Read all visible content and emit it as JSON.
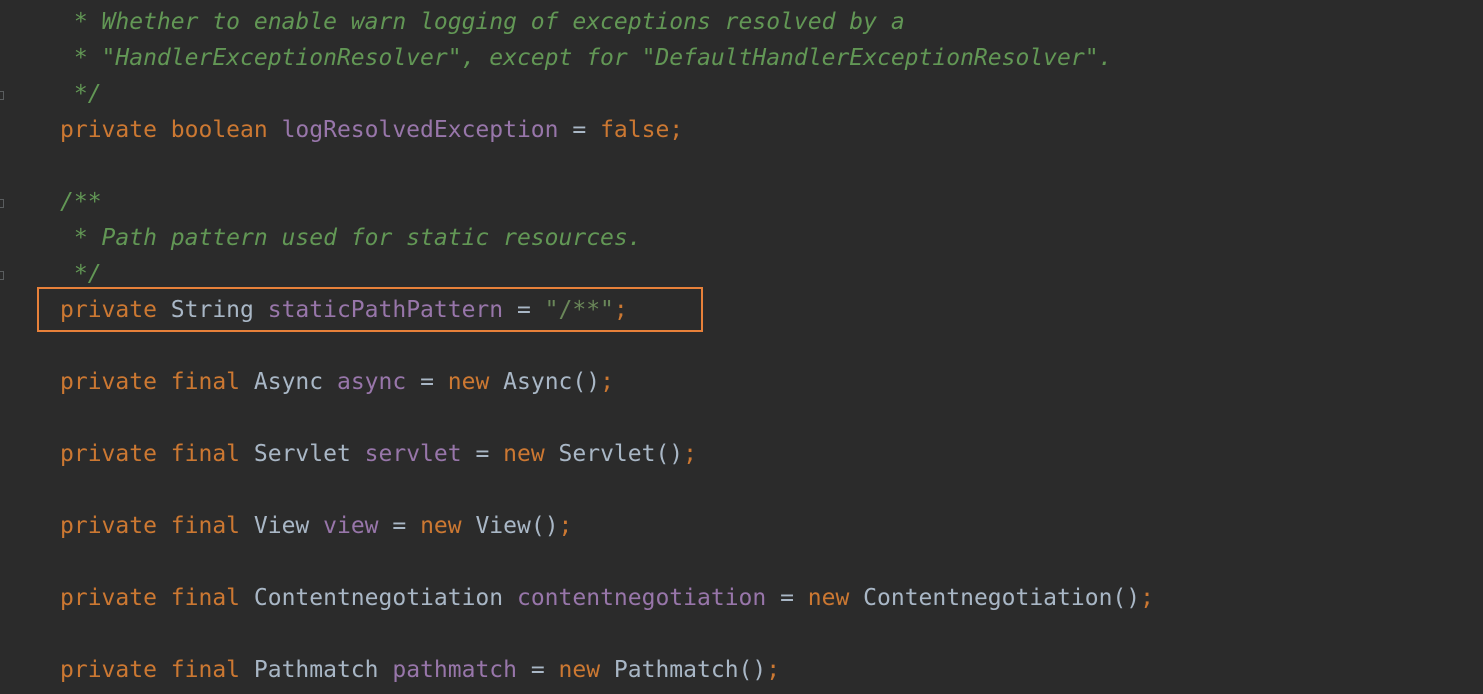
{
  "lines": [
    {
      "segments": [
        {
          "c": "doc",
          "t": " * Whether to enable warn logging of exceptions resolved by a"
        }
      ]
    },
    {
      "segments": [
        {
          "c": "doc",
          "t": " * \"HandlerExceptionResolver\", except for \"DefaultHandlerExceptionResolver\"."
        }
      ]
    },
    {
      "segments": [
        {
          "c": "doc",
          "t": " */"
        }
      ]
    },
    {
      "segments": [
        {
          "c": "kw",
          "t": "private boolean "
        },
        {
          "c": "field",
          "t": "logResolvedException"
        },
        {
          "c": "plain",
          "t": " = "
        },
        {
          "c": "kw",
          "t": "false;"
        }
      ]
    },
    {
      "segments": []
    },
    {
      "segments": [
        {
          "c": "doc",
          "t": "/**"
        }
      ]
    },
    {
      "segments": [
        {
          "c": "doc",
          "t": " * Path pattern used for static resources."
        }
      ]
    },
    {
      "segments": [
        {
          "c": "doc",
          "t": " */"
        }
      ]
    },
    {
      "segments": [
        {
          "c": "kw",
          "t": "private "
        },
        {
          "c": "plain",
          "t": "String "
        },
        {
          "c": "field",
          "t": "staticPathPattern"
        },
        {
          "c": "plain",
          "t": " = "
        },
        {
          "c": "str",
          "t": "\"/**\""
        },
        {
          "c": "kw",
          "t": ";"
        }
      ]
    },
    {
      "segments": []
    },
    {
      "segments": [
        {
          "c": "kw",
          "t": "private final "
        },
        {
          "c": "plain",
          "t": "Async "
        },
        {
          "c": "field",
          "t": "async"
        },
        {
          "c": "plain",
          "t": " = "
        },
        {
          "c": "kw",
          "t": "new "
        },
        {
          "c": "plain",
          "t": "Async()"
        },
        {
          "c": "kw",
          "t": ";"
        }
      ]
    },
    {
      "segments": []
    },
    {
      "segments": [
        {
          "c": "kw",
          "t": "private final "
        },
        {
          "c": "plain",
          "t": "Servlet "
        },
        {
          "c": "field",
          "t": "servlet"
        },
        {
          "c": "plain",
          "t": " = "
        },
        {
          "c": "kw",
          "t": "new "
        },
        {
          "c": "plain",
          "t": "Servlet()"
        },
        {
          "c": "kw",
          "t": ";"
        }
      ]
    },
    {
      "segments": []
    },
    {
      "segments": [
        {
          "c": "kw",
          "t": "private final "
        },
        {
          "c": "plain",
          "t": "View "
        },
        {
          "c": "field",
          "t": "view"
        },
        {
          "c": "plain",
          "t": " = "
        },
        {
          "c": "kw",
          "t": "new "
        },
        {
          "c": "plain",
          "t": "View()"
        },
        {
          "c": "kw",
          "t": ";"
        }
      ]
    },
    {
      "segments": []
    },
    {
      "segments": [
        {
          "c": "kw",
          "t": "private final "
        },
        {
          "c": "plain",
          "t": "Contentnegotiation "
        },
        {
          "c": "field",
          "t": "contentnegotiation"
        },
        {
          "c": "plain",
          "t": " = "
        },
        {
          "c": "kw",
          "t": "new "
        },
        {
          "c": "plain",
          "t": "Contentnegotiation()"
        },
        {
          "c": "kw",
          "t": ";"
        }
      ]
    },
    {
      "segments": []
    },
    {
      "segments": [
        {
          "c": "kw",
          "t": "private final "
        },
        {
          "c": "plain",
          "t": "Pathmatch "
        },
        {
          "c": "field",
          "t": "pathmatch"
        },
        {
          "c": "plain",
          "t": " = "
        },
        {
          "c": "kw",
          "t": "new "
        },
        {
          "c": "plain",
          "t": "Pathmatch()"
        },
        {
          "c": "kw",
          "t": ";"
        }
      ]
    }
  ],
  "highlighted_line": 8,
  "colors": {
    "background": "#2b2b2b",
    "keyword": "#cc7832",
    "field": "#9876aa",
    "string": "#6a8759",
    "doc_comment": "#629755",
    "plain": "#a9b7c6",
    "highlight_border": "#e8813a"
  }
}
